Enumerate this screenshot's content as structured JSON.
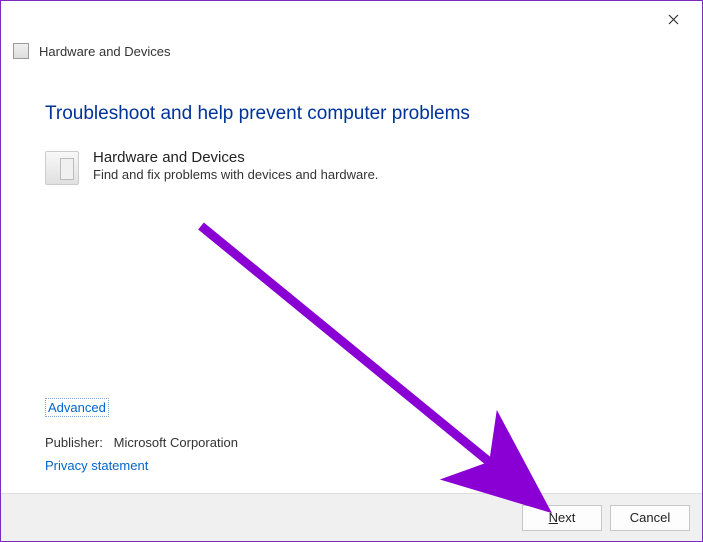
{
  "window": {
    "title": "Hardware and Devices"
  },
  "main": {
    "heading": "Troubleshoot and help prevent computer problems",
    "item_title": "Hardware and Devices",
    "item_desc": "Find and fix problems with devices and hardware."
  },
  "links": {
    "advanced": "Advanced",
    "privacy": "Privacy statement"
  },
  "publisher": {
    "label": "Publisher:",
    "value": "Microsoft Corporation"
  },
  "buttons": {
    "next_accel": "N",
    "next_rest": "ext",
    "cancel": "Cancel"
  }
}
